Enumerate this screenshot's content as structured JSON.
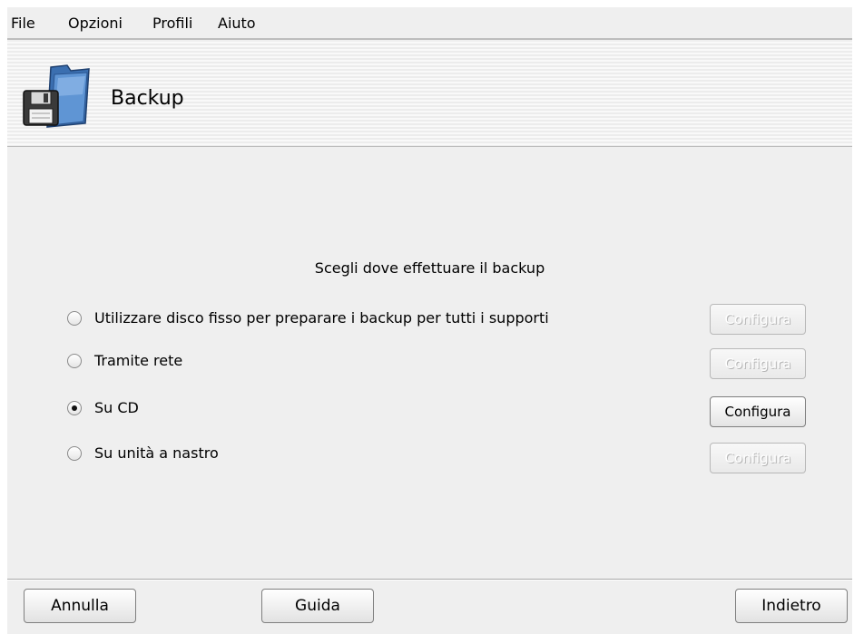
{
  "menubar": {
    "items": [
      {
        "label": "File"
      },
      {
        "label": "Opzioni"
      },
      {
        "label": "Profili"
      },
      {
        "label": "Aiuto"
      }
    ]
  },
  "banner": {
    "title": "Backup",
    "icon": "floppy-folder-icon"
  },
  "prompt": "Scegli dove effettuare il backup",
  "options": [
    {
      "label": "Utilizzare disco fisso per preparare i backup per tutti i supporti",
      "selected": false,
      "configure_label": "Configura",
      "configure_enabled": false
    },
    {
      "label": "Tramite rete",
      "selected": false,
      "configure_label": "Configura",
      "configure_enabled": false
    },
    {
      "label": "Su CD",
      "selected": true,
      "configure_label": "Configura",
      "configure_enabled": true
    },
    {
      "label": "Su unità a nastro",
      "selected": false,
      "configure_label": "Configura",
      "configure_enabled": false
    }
  ],
  "buttons": {
    "cancel": "Annulla",
    "help": "Guida",
    "back": "Indietro"
  },
  "colors": {
    "window_bg": "#efefef",
    "disabled_text": "#ffffff"
  }
}
